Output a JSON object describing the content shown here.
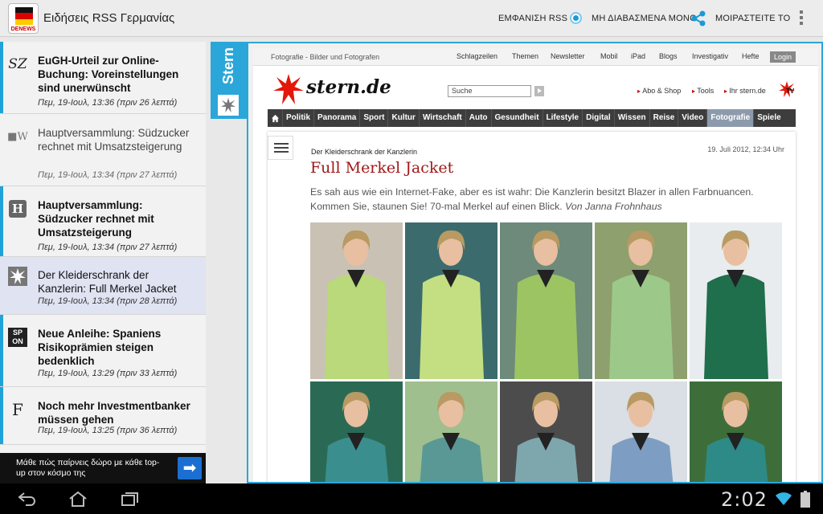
{
  "actionbar": {
    "app_label": "DENEWS",
    "title": "Ειδήσεις RSS Γερμανίας",
    "show_rss": "ΕΜΦΑΝΙΣΗ RSS",
    "unread_only": "ΜΗ ΔΙΑΒΑΣΜΕΝΑ ΜΟΝΟ",
    "share": "ΜΟΙΡΑΣΤΕΙΤΕ ΤΟ",
    "icons": [
      "app-icon",
      "radio-icon",
      "share-icon",
      "overflow-menu-icon"
    ]
  },
  "feed": {
    "items": [
      {
        "source_icon": "SZ",
        "title": "EuGH-Urteil zur Online-Buchung: Voreinstellungen sind unerwünscht",
        "date": "Πεμ, 19-Ιουλ, 13:36 (πριν 26 λεπτά)"
      },
      {
        "source_icon": "■W",
        "title": "Hauptversammlung: Südzucker rechnet mit Umsatzsteigerung",
        "date": "Πεμ, 19-Ιουλ, 13:34 (πριν 27 λεπτά)"
      },
      {
        "source_icon": "H",
        "title": "Hauptversammlung: Südzucker rechnet mit Umsatzsteigerung",
        "date": "Πεμ, 19-Ιουλ, 13:34 (πριν 27 λεπτά)"
      },
      {
        "source_icon": "stern-star",
        "title": "Der Kleiderschrank der Kanzlerin: Full Merkel Jacket",
        "date": "Πεμ, 19-Ιουλ, 13:34 (πριν 28 λεπτά)"
      },
      {
        "source_icon": "SP ON",
        "title": "Neue Anleihe: Spaniens Risikoprämien steigen bedenklich",
        "date": "Πεμ, 19-Ιουλ, 13:29 (πριν 33 λεπτά)"
      },
      {
        "source_icon": "F",
        "title": "Noch mehr Investmentbanker müssen gehen",
        "date": "Πεμ, 19-Ιουλ, 13:25 (πριν 36 λεπτά)"
      }
    ]
  },
  "ad": {
    "text": "Μάθε πώς παίρνεις δώρο με κάθε top-up στον κόσμο της",
    "arrow": "➡"
  },
  "source_tab": {
    "label": "Stern"
  },
  "web": {
    "topstrip": {
      "crumb": "Fotografie - Bilder und Fotografen",
      "links": [
        "Schlagzeilen",
        "Themen",
        "Newsletter",
        "Mobil",
        "iPad",
        "Blogs",
        "Investigativ",
        "Hefte"
      ],
      "login": "Login"
    },
    "logo_text": "stern.de",
    "search_placeholder": "Suche",
    "header_links": [
      "Abo & Shop",
      "Tools",
      "Ihr stern.de"
    ],
    "nav": [
      "Politik",
      "Panorama",
      "Sport",
      "Kultur",
      "Wirtschaft",
      "Auto",
      "Gesundheit",
      "Lifestyle",
      "Digital",
      "Wissen",
      "Reise",
      "Video",
      "Fotografie",
      "Spiele"
    ],
    "nav_active": "Fotografie",
    "article": {
      "kicker": "Der Kleiderschrank der Kanzlerin",
      "date": "19. Juli 2012, 12:34 Uhr",
      "headline": "Full Merkel Jacket",
      "teaser": "Es sah aus wie ein Internet-Fake, aber es ist wahr: Die Kanzlerin besitzt Blazer in allen Farbnuancen. Kommen Sie, staunen Sie! 70-mal Merkel auf einen Blick.",
      "author": "Von Janna Frohnhaus"
    },
    "gallery_colors": [
      "#b9d97a",
      "#c3df82",
      "#9cc463",
      "#9cc98a",
      "#1f6e4c",
      "#3a8f8e",
      "#5a9896",
      "#7ea7ad",
      "#7e9dc2",
      "#2d8a86"
    ]
  },
  "statusbar": {
    "clock": "2:02"
  },
  "colors": {
    "accent": "#2ba6d9",
    "headline": "#a01818",
    "nav_bg": "#3d3d3d"
  }
}
